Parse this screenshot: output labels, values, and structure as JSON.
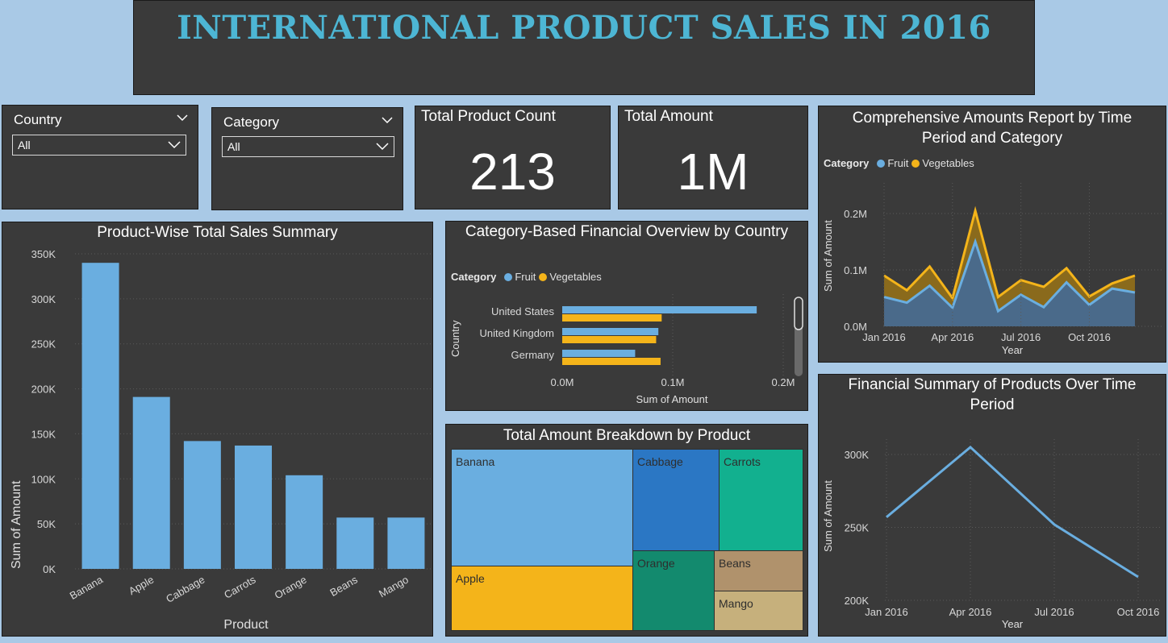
{
  "title": "INTERNATIONAL PRODUCT SALES IN 2016",
  "slicers": {
    "country": {
      "label": "Country",
      "value": "All"
    },
    "category": {
      "label": "Category",
      "value": "All"
    }
  },
  "kpis": {
    "count": {
      "label": "Total Product Count",
      "value": "213"
    },
    "amount": {
      "label": "Total Amount",
      "value": "1M"
    }
  },
  "colors": {
    "fruit": "#6aaee0",
    "vegetables": "#f4b41a",
    "cabbage": "#2b77c4",
    "carrots": "#12b08f",
    "orange": "#138a6e",
    "beans": "#b0926c",
    "mango": "#c6b07c",
    "apple": "#f4b41a"
  },
  "chart_data": [
    {
      "id": "product_bar",
      "type": "bar",
      "title": "Product-Wise Total Sales Summary",
      "xlabel": "Product",
      "ylabel": "Sum of Amount",
      "categories": [
        "Banana",
        "Apple",
        "Cabbage",
        "Carrots",
        "Orange",
        "Beans",
        "Mango"
      ],
      "values": [
        340000,
        191000,
        142000,
        137000,
        104000,
        57000,
        57000
      ],
      "ylim": [
        0,
        350000
      ],
      "yticks": [
        "0K",
        "50K",
        "100K",
        "150K",
        "200K",
        "250K",
        "300K",
        "350K"
      ],
      "grid": true
    },
    {
      "id": "country_bar",
      "type": "bar",
      "orientation": "horizontal",
      "title": "Category-Based Financial Overview by Country",
      "xlabel": "Sum of Amount",
      "ylabel": "Country",
      "legend_title": "Category",
      "categories": [
        "United States",
        "United Kingdom",
        "Germany"
      ],
      "series": [
        {
          "name": "Fruit",
          "values": [
            0.176,
            0.087,
            0.066
          ]
        },
        {
          "name": "Vegetables",
          "values": [
            0.09,
            0.085,
            0.089
          ]
        }
      ],
      "xticks": [
        "0.0M",
        "0.1M",
        "0.2M"
      ],
      "xlim": [
        0,
        0.2
      ]
    },
    {
      "id": "treemap",
      "type": "treemap",
      "title": "Total Amount Breakdown by Product",
      "labels": [
        "Banana",
        "Apple",
        "Cabbage",
        "Carrots",
        "Orange",
        "Beans",
        "Mango"
      ],
      "values": [
        340000,
        191000,
        142000,
        137000,
        104000,
        57000,
        57000
      ]
    },
    {
      "id": "time_area",
      "type": "area",
      "stacked": true,
      "title": "Comprehensive Amounts Report by Time Period and Category",
      "xlabel": "Year",
      "ylabel": "Sum of Amount",
      "legend_title": "Category",
      "xticks": [
        "Jan 2016",
        "Apr 2016",
        "Jul 2016",
        "Oct 2016"
      ],
      "yticks": [
        "0.0M",
        "0.1M",
        "0.2M"
      ],
      "ylim": [
        0,
        0.2
      ],
      "series": [
        {
          "name": "Fruit",
          "values": [
            0.052,
            0.042,
            0.072,
            0.033,
            0.15,
            0.027,
            0.056,
            0.034,
            0.078,
            0.038,
            0.067,
            0.06
          ]
        },
        {
          "name": "Vegetables",
          "values": [
            0.038,
            0.022,
            0.034,
            0.017,
            0.055,
            0.025,
            0.026,
            0.036,
            0.025,
            0.015,
            0.009,
            0.03
          ]
        }
      ]
    },
    {
      "id": "time_line",
      "type": "line",
      "title": "Financial Summary of Products Over Time Period",
      "xlabel": "Year",
      "ylabel": "Sum of Amount",
      "x": [
        "Jan 2016",
        "Apr 2016",
        "Jul 2016",
        "Oct 2016"
      ],
      "values": [
        257000,
        305000,
        252000,
        216000
      ],
      "ylim": [
        200000,
        320000
      ],
      "yticks": [
        "200K",
        "250K",
        "300K"
      ]
    }
  ]
}
